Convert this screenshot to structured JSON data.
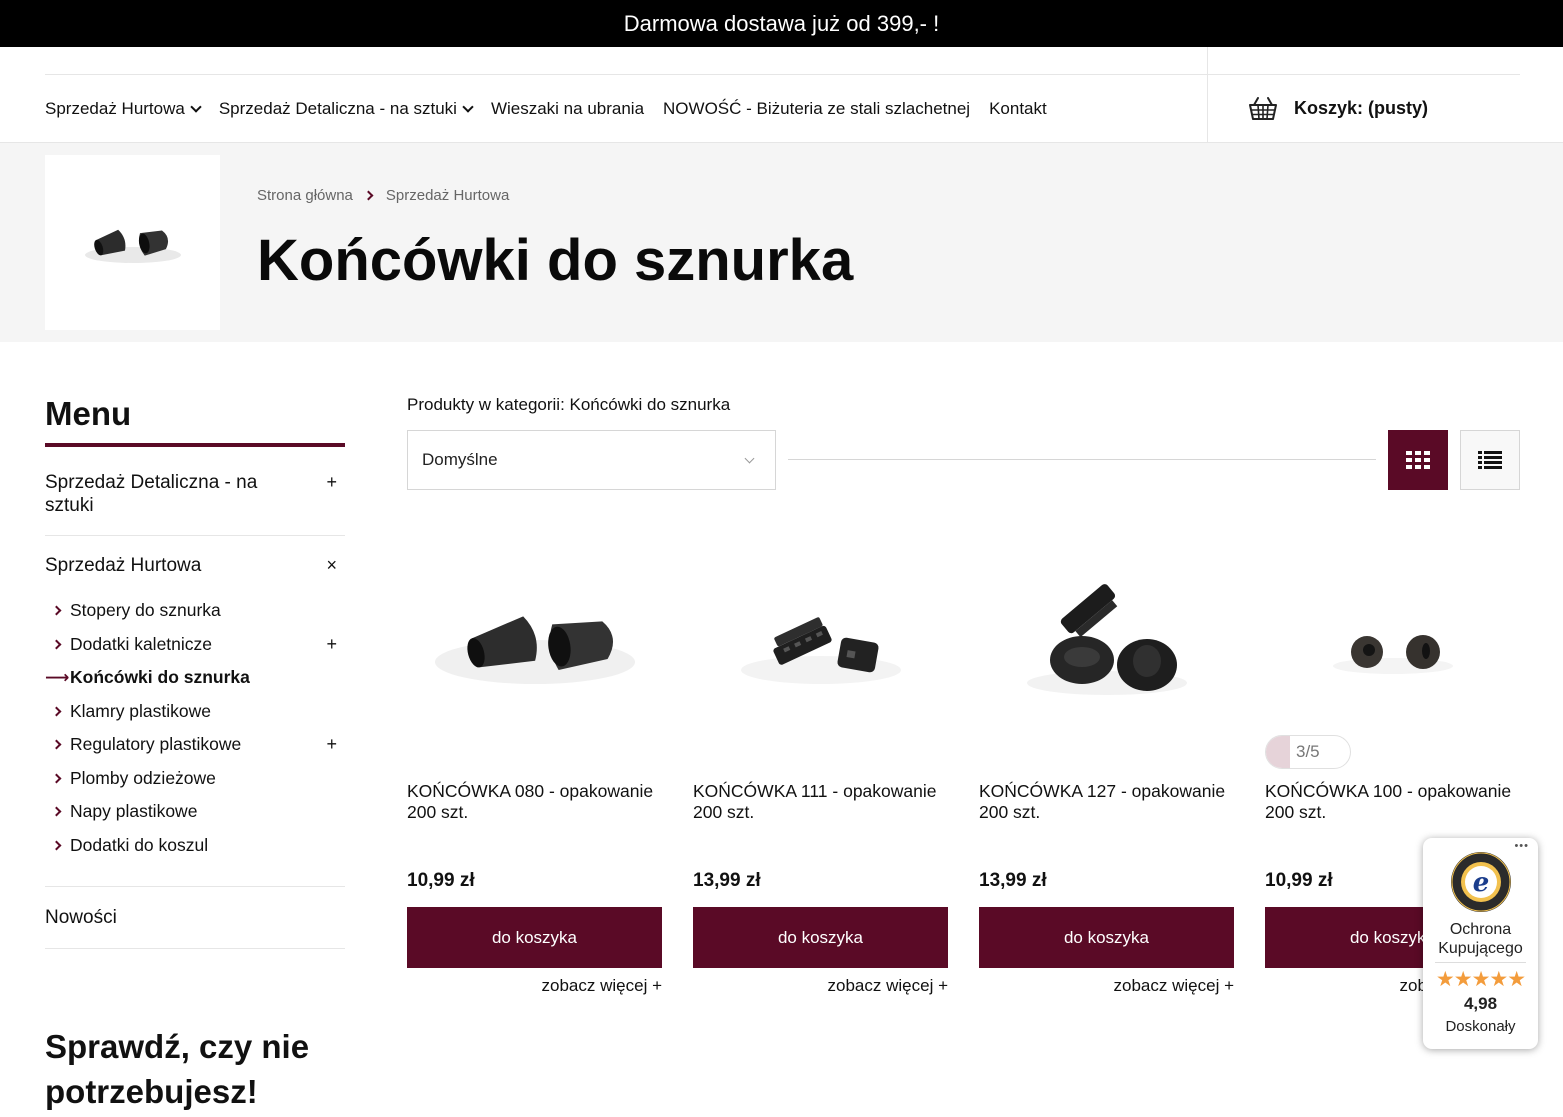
{
  "topbar": {
    "text": "Darmowa dostawa już od 399,- !"
  },
  "nav": {
    "items": [
      {
        "label": "Sprzedaż Hurtowa",
        "has_dropdown": true
      },
      {
        "label": "Sprzedaż Detaliczna - na sztuki",
        "has_dropdown": true
      },
      {
        "label": "Wieszaki na ubrania",
        "has_dropdown": false
      },
      {
        "label": "NOWOŚĆ - Biżuteria ze stali szlachetnej",
        "has_dropdown": false
      },
      {
        "label": "Kontakt",
        "has_dropdown": false
      }
    ],
    "cart_label": "Koszyk: (pusty)",
    "cart_icon": "basket-icon"
  },
  "hero": {
    "breadcrumb": [
      "Strona główna",
      "Sprzedaż Hurtowa"
    ],
    "title": "Końcówki do sznurka"
  },
  "sidebar": {
    "title": "Menu",
    "categories": [
      {
        "label": "Sprzedaż Detaliczna - na sztuki",
        "toggle": "+"
      },
      {
        "label": "Sprzedaż Hurtowa",
        "toggle": "×",
        "subitems": [
          {
            "label": "Stopery do sznurka",
            "toggle": ""
          },
          {
            "label": "Dodatki kaletnicze",
            "toggle": "+"
          },
          {
            "label": "Końcówki do sznurka",
            "toggle": "",
            "active": true
          },
          {
            "label": "Klamry plastikowe",
            "toggle": ""
          },
          {
            "label": "Regulatory plastikowe",
            "toggle": "+"
          },
          {
            "label": "Plomby odzieżowe",
            "toggle": ""
          },
          {
            "label": "Napy plastikowe",
            "toggle": ""
          },
          {
            "label": "Dodatki do koszul",
            "toggle": ""
          }
        ]
      },
      {
        "label": "Nowości",
        "toggle": ""
      }
    ],
    "promo_title": "Sprawdź, czy nie potrzebujesz!"
  },
  "main": {
    "heading": "Produkty w kategorii: Końcówki do sznurka",
    "sort_value": "Domyślne",
    "view_grid_icon": "grid-view-icon",
    "view_list_icon": "list-view-icon",
    "products": [
      {
        "name": "KOŃCÓWKA 080 - opakowanie 200 szt.",
        "price": "10,99 zł",
        "button": "do koszyka",
        "more": "zobacz więcej +"
      },
      {
        "name": "KOŃCÓWKA 111 - opakowanie 200 szt.",
        "price": "13,99 zł",
        "button": "do koszyka",
        "more": "zobacz więcej +"
      },
      {
        "name": "KOŃCÓWKA 127 - opakowanie 200 szt.",
        "price": "13,99 zł",
        "button": "do koszyka",
        "more": "zobacz więcej +"
      },
      {
        "name": "KOŃCÓWKA 100 - opakowanie 200 szt.",
        "price": "10,99 zł",
        "button": "do koszyka",
        "more": "zobacz więcej +",
        "badge": "3/5"
      }
    ]
  },
  "trust": {
    "label_line1": "Ochrona",
    "label_line2": "Kupującego",
    "stars": "★★★★★",
    "rating": 4.98,
    "score": "4,98",
    "grade": "Doskonały",
    "menu": "•••"
  },
  "colors": {
    "brand": "#5a0a26",
    "star": "#f39c3c",
    "hero_bg": "#f5f5f5"
  }
}
